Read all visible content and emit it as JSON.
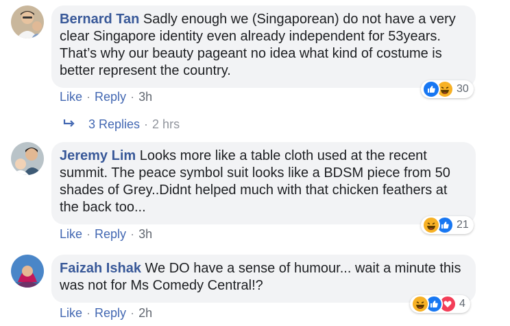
{
  "comments": [
    {
      "author": "Bernard Tan",
      "text": "Sadly enough we (Singaporean) do not have a very clear Singapore identity even already independent for 53years. That’s why our beauty pageant no idea what kind of costume is better represent the country.",
      "actions": {
        "like": "Like",
        "reply": "Reply",
        "time": "3h"
      },
      "reactions": {
        "icons": [
          "like-icon",
          "haha-icon"
        ],
        "count": "30"
      }
    },
    {
      "author": "Jeremy Lim",
      "text": "Looks more like a table cloth used at the recent summit. The peace symbol suit looks like a BDSM piece from 50 shades of Grey..Didnt helped much with that chicken feathers at the back too...",
      "actions": {
        "like": "Like",
        "reply": "Reply",
        "time": "3h"
      },
      "reactions": {
        "icons": [
          "haha-icon",
          "like-icon"
        ],
        "count": "21"
      }
    },
    {
      "author": "Faizah Ishak",
      "text": "We DO have a sense of humour... wait a minute this was not for Ms Comedy Central!?",
      "actions": {
        "like": "Like",
        "reply": "Reply",
        "time": "2h"
      },
      "reactions": {
        "icons": [
          "haha-icon",
          "like-icon",
          "love-icon"
        ],
        "count": "4"
      }
    }
  ],
  "replies_link": {
    "label": "3 Replies",
    "time": "2 hrs",
    "icon": "reply-arrow-icon"
  },
  "colors": {
    "link": "#4267b2",
    "author": "#385898",
    "bubble": "#f2f3f5",
    "like": "#1877f2",
    "haha": "#f7b125",
    "love": "#f33e58"
  }
}
